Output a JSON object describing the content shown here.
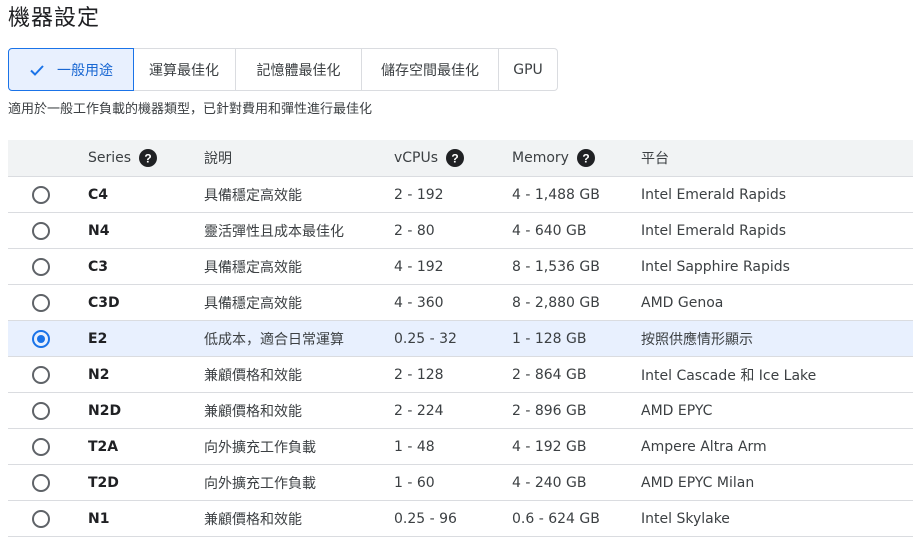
{
  "page": {
    "title": "機器設定",
    "subtitle": "適用於一般工作負載的機器類型，已針對費用和彈性進行最佳化"
  },
  "tabs": [
    {
      "label": "一般用途",
      "selected": true
    },
    {
      "label": "運算最佳化",
      "selected": false
    },
    {
      "label": "記憶體最佳化",
      "selected": false
    },
    {
      "label": "儲存空間最佳化",
      "selected": false
    },
    {
      "label": "GPU",
      "selected": false
    }
  ],
  "table": {
    "headers": {
      "series": "Series",
      "description": "說明",
      "vcpus": "vCPUs",
      "memory": "Memory",
      "platform": "平台"
    },
    "rows": [
      {
        "series": "C4",
        "description": "具備穩定高效能",
        "vcpus": "2 - 192",
        "memory": "4 - 1,488 GB",
        "platform": "Intel Emerald Rapids",
        "selected": false
      },
      {
        "series": "N4",
        "description": "靈活彈性且成本最佳化",
        "vcpus": "2 - 80",
        "memory": "4 - 640 GB",
        "platform": "Intel Emerald Rapids",
        "selected": false
      },
      {
        "series": "C3",
        "description": "具備穩定高效能",
        "vcpus": "4 - 192",
        "memory": "8 - 1,536 GB",
        "platform": "Intel Sapphire Rapids",
        "selected": false
      },
      {
        "series": "C3D",
        "description": "具備穩定高效能",
        "vcpus": "4 - 360",
        "memory": "8 - 2,880 GB",
        "platform": "AMD Genoa",
        "selected": false
      },
      {
        "series": "E2",
        "description": "低成本，適合日常運算",
        "vcpus": "0.25 - 32",
        "memory": "1 - 128 GB",
        "platform": "按照供應情形顯示",
        "selected": true
      },
      {
        "series": "N2",
        "description": "兼顧價格和效能",
        "vcpus": "2 - 128",
        "memory": "2 - 864 GB",
        "platform": "Intel Cascade 和 Ice Lake",
        "selected": false
      },
      {
        "series": "N2D",
        "description": "兼顧價格和效能",
        "vcpus": "2 - 224",
        "memory": "2 - 896 GB",
        "platform": "AMD EPYC",
        "selected": false
      },
      {
        "series": "T2A",
        "description": "向外擴充工作負載",
        "vcpus": "1 - 48",
        "memory": "4 - 192 GB",
        "platform": "Ampere Altra Arm",
        "selected": false
      },
      {
        "series": "T2D",
        "description": "向外擴充工作負載",
        "vcpus": "1 - 60",
        "memory": "4 - 240 GB",
        "platform": "AMD EPYC Milan",
        "selected": false
      },
      {
        "series": "N1",
        "description": "兼顧價格和效能",
        "vcpus": "0.25 - 96",
        "memory": "0.6 - 624 GB",
        "platform": "Intel Skylake",
        "selected": false
      }
    ]
  },
  "icons": {
    "check": "check-icon",
    "help": "help-circle-icon"
  },
  "colors": {
    "accent": "#1a73e8",
    "selected_bg": "#e8f0fe",
    "border": "#dadce0"
  }
}
